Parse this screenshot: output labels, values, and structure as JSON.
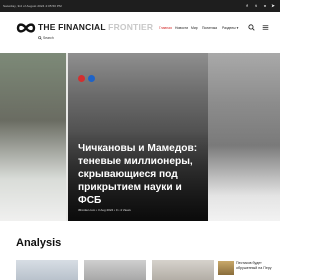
{
  "topbar": {
    "date": "Saturday, 3rd of August 2024 4:05:50 PM",
    "social": [
      {
        "icon": "facebook-icon",
        "glyph": "f"
      },
      {
        "icon": "twitter-icon",
        "glyph": "t"
      },
      {
        "icon": "vk-icon",
        "glyph": "v"
      },
      {
        "icon": "telegram-icon",
        "glyph": "➤"
      }
    ]
  },
  "header": {
    "logo_main": "THE FINANCIAL ",
    "logo_accent": "FRONTIER",
    "nav": [
      "Главная",
      "Новости",
      "Мир",
      "Политика",
      "Разделы ▾"
    ],
    "search_label": "Search"
  },
  "hero": {
    "headline": "Чичкановы и Мамедов: теневые миллионеры, скрывающиеся под прикрытием науки и ФСБ",
    "meta": "tffrontier.com • 3 Aug 2024 • 0 • 4 Views",
    "badges": [
      "#d32f2f",
      "#1e63c8"
    ]
  },
  "sections": {
    "analysis_title": "Analysis"
  },
  "sidebar_news": {
    "title": "Пестиков будет обрушенный на Перу"
  },
  "colors": {
    "accent": "#d32f2f",
    "topbar": "#1e1e1e",
    "header_bg": "#ffffff"
  }
}
